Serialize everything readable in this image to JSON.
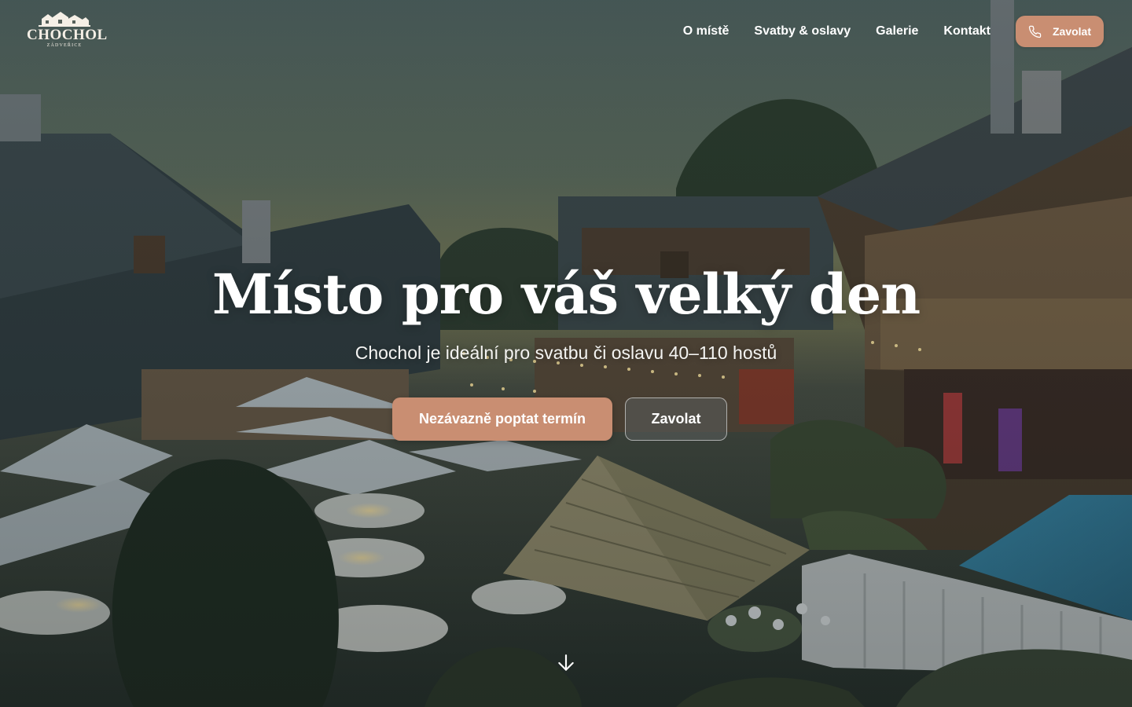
{
  "brand": {
    "name": "CHOCHOL",
    "subtitle": "ZÁDVEŘICE"
  },
  "nav": {
    "links": [
      "O místě",
      "Svatby & oslavy",
      "Galerie",
      "Kontakt"
    ],
    "call_label": "Zavolat"
  },
  "hero": {
    "title": "Místo pro váš velký den",
    "subtitle": "Chochol je ideální pro svatbu či oslavu 40–110 hostů",
    "primary_cta": "Nezávazně poptat termín",
    "secondary_cta": "Zavolat"
  },
  "icons": {
    "phone": "phone-icon",
    "scroll": "arrow-down-icon"
  },
  "colors": {
    "accent": "#c98e72",
    "text": "#ffffff"
  }
}
